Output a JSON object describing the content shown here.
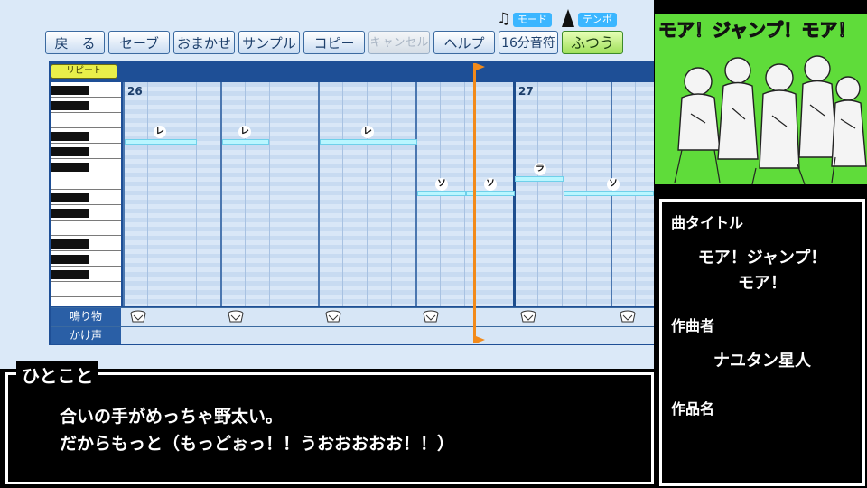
{
  "toolbar": {
    "buttons": [
      "戻　る",
      "セーブ",
      "おまかせ",
      "サンプル",
      "コピー",
      "キャンセル",
      "ヘルプ"
    ],
    "mode_label": "モード",
    "tempo_label": "テンポ",
    "step_value": "16分音符",
    "tempo_value": "ふつう"
  },
  "editor": {
    "repeat_label": "リピート",
    "measures": [
      "26",
      "27"
    ],
    "lyrics": [
      "レ",
      "レ",
      "レ",
      "ソ",
      "ソ",
      "ラ",
      "ソ"
    ],
    "tracks": [
      "鳴り物",
      "かけ声"
    ]
  },
  "info": {
    "title_label": "曲タイトル",
    "title_line1": "モア！ジャンプ！",
    "title_line2": "モア！",
    "composer_label": "作曲者",
    "composer": "ナユタン星人",
    "work_label": "作品名",
    "work": ""
  },
  "comment": {
    "header": "ひとこと",
    "line1": "合いの手がめっちゃ野太い。",
    "line2": "だからもっと（もっどぉっ！！うおおおおお！！）"
  },
  "cover": {
    "title": "モア！ジャンプ！モア！"
  },
  "colors": {
    "background": "#000000",
    "grid": "#c8dbf1",
    "note": "#b9f6ff",
    "playhead": "#f28a1a",
    "art_bg": "#5fdc3a"
  }
}
